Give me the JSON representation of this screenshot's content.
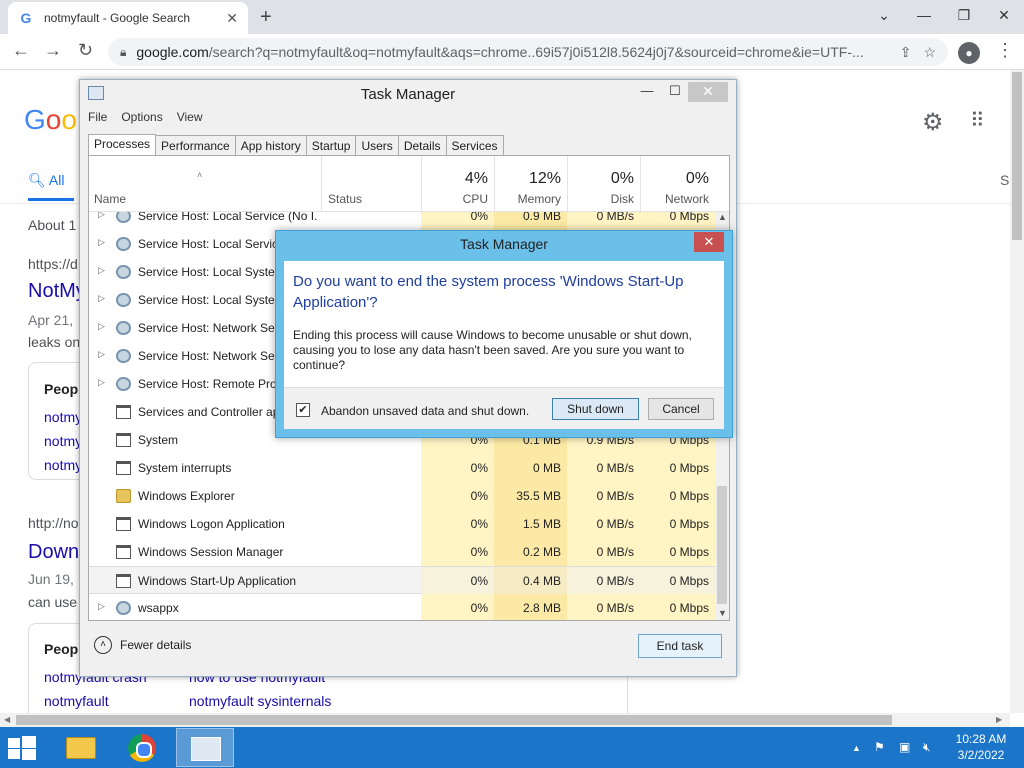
{
  "browser": {
    "tab_title": "notmyfault - Google Search",
    "tab_favicon": "G",
    "url_host": "google.com",
    "url_rest": "/search?q=notmyfault&oq=notmyfault&aqs=chrome..69i57j0i512l8.5624j0j7&sourceid=chrome&ie=UTF-...",
    "new_tab": "+",
    "window_controls": [
      "⌄",
      "—",
      "❐",
      "✕"
    ]
  },
  "google": {
    "logo": [
      "G",
      "o",
      "o"
    ],
    "nav_all": "All",
    "nav_s": "S",
    "about": "About 1",
    "result1_url": "https://d",
    "result1_title": "NotMy",
    "result1_date": "Apr 21,",
    "result1_snippet": "leaks on",
    "card1_title": "Peopl",
    "card1_links": [
      "notmy",
      "notmy",
      "notmy"
    ],
    "result2_url": "http://no",
    "result2_title": "Down",
    "result2_date": "Jun 19,",
    "result2_snippet": "can use",
    "card2_title": "Peopl",
    "card2_left": [
      "notmyfault crash",
      "notmyfault"
    ],
    "card2_right": [
      "how to use notmyfault",
      "notmyfault sysinternals"
    ]
  },
  "taskmanager": {
    "title": "Task Manager",
    "menu": [
      "File",
      "Options",
      "View"
    ],
    "tabs": [
      "Processes",
      "Performance",
      "App history",
      "Startup",
      "Users",
      "Details",
      "Services"
    ],
    "active_tab": "Processes",
    "header": {
      "name": "Name",
      "status": "Status",
      "cpu_pct": "4%",
      "cpu_label": "CPU",
      "mem_pct": "12%",
      "mem_label": "Memory",
      "disk_pct": "0%",
      "disk_label": "Disk",
      "net_pct": "0%",
      "net_label": "Network"
    },
    "rows": [
      {
        "name": "Service Host: Local Service (No I...",
        "icon": "gear",
        "expand": true,
        "cpu": "0%",
        "mem": "0.9 MB",
        "disk": "0 MB/s",
        "net": "0 Mbps"
      },
      {
        "name": "Service Host: Local Service",
        "icon": "gear",
        "expand": true,
        "cpu": "",
        "mem": "",
        "disk": "",
        "net": ""
      },
      {
        "name": "Service Host: Local System",
        "icon": "gear",
        "expand": true,
        "cpu": "",
        "mem": "",
        "disk": "",
        "net": ""
      },
      {
        "name": "Service Host: Local System",
        "icon": "gear",
        "expand": true,
        "cpu": "",
        "mem": "",
        "disk": "",
        "net": ""
      },
      {
        "name": "Service Host: Network Serv",
        "icon": "gear",
        "expand": true,
        "cpu": "",
        "mem": "",
        "disk": "",
        "net": ""
      },
      {
        "name": "Service Host: Network Serv",
        "icon": "gear",
        "expand": true,
        "cpu": "",
        "mem": "",
        "disk": "",
        "net": ""
      },
      {
        "name": "Service Host: Remote Proc",
        "icon": "gear",
        "expand": true,
        "cpu": "",
        "mem": "",
        "disk": "",
        "net": ""
      },
      {
        "name": "Services and Controller ap",
        "icon": "win",
        "expand": false,
        "cpu": "",
        "mem": "",
        "disk": "",
        "net": ""
      },
      {
        "name": "System",
        "icon": "win",
        "expand": false,
        "cpu": "0%",
        "mem": "0.1 MB",
        "disk": "0.9 MB/s",
        "net": "0 Mbps"
      },
      {
        "name": "System interrupts",
        "icon": "win",
        "expand": false,
        "cpu": "0%",
        "mem": "0 MB",
        "disk": "0 MB/s",
        "net": "0 Mbps"
      },
      {
        "name": "Windows Explorer",
        "icon": "folder",
        "expand": false,
        "cpu": "0%",
        "mem": "35.5 MB",
        "disk": "0 MB/s",
        "net": "0 Mbps"
      },
      {
        "name": "Windows Logon Application",
        "icon": "win",
        "expand": false,
        "cpu": "0%",
        "mem": "1.5 MB",
        "disk": "0 MB/s",
        "net": "0 Mbps"
      },
      {
        "name": "Windows Session Manager",
        "icon": "win",
        "expand": false,
        "cpu": "0%",
        "mem": "0.2 MB",
        "disk": "0 MB/s",
        "net": "0 Mbps"
      },
      {
        "name": "Windows Start-Up Application",
        "icon": "win",
        "expand": false,
        "cpu": "0%",
        "mem": "0.4 MB",
        "disk": "0 MB/s",
        "net": "0 Mbps",
        "selected": true
      },
      {
        "name": "wsappx",
        "icon": "gear",
        "expand": true,
        "cpu": "0%",
        "mem": "2.8 MB",
        "disk": "0 MB/s",
        "net": "0 Mbps"
      }
    ],
    "fewer_details": "Fewer details",
    "end_task": "End task"
  },
  "dialog": {
    "title": "Task Manager",
    "heading": "Do you want to end the system process 'Windows Start-Up Application'?",
    "body": "Ending this process will cause Windows to become unusable or shut down, causing you to lose any data hasn't been saved. Are you sure you want to continue?",
    "checkbox_label": "Abandon unsaved data and shut down.",
    "checkbox_checked": true,
    "shutdown_label": "Shut down",
    "cancel_label": "Cancel"
  },
  "taskbar": {
    "time": "10:28 AM",
    "date": "3/2/2022"
  }
}
